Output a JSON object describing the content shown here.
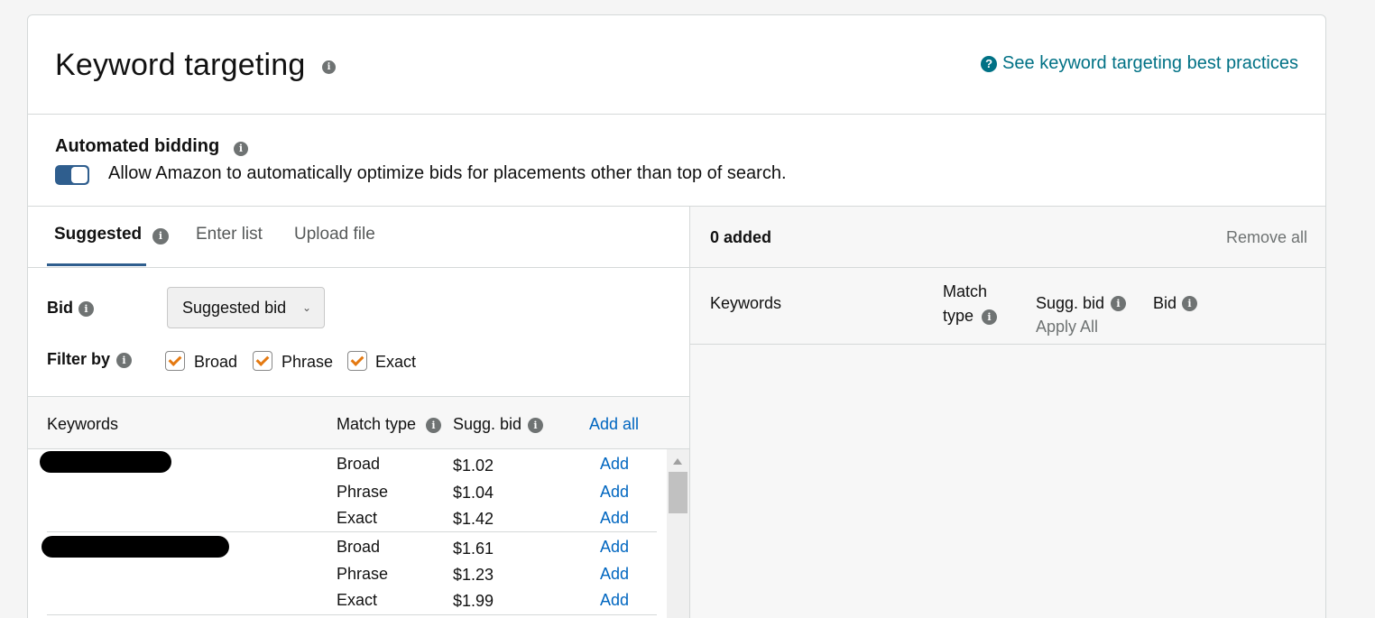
{
  "header": {
    "title": "Keyword targeting",
    "best_practices_link": "See keyword targeting best practices"
  },
  "automated_bidding": {
    "title": "Automated bidding",
    "toggle_on": true,
    "description": "Allow Amazon to automatically optimize bids for placements other than top of search."
  },
  "tabs": [
    {
      "label": "Suggested",
      "active": true
    },
    {
      "label": "Enter list",
      "active": false
    },
    {
      "label": "Upload file",
      "active": false
    }
  ],
  "filters": {
    "bid_label": "Bid",
    "bid_selected": "Suggested bid",
    "filter_label": "Filter by",
    "match_options": [
      {
        "label": "Broad",
        "checked": true
      },
      {
        "label": "Phrase",
        "checked": true
      },
      {
        "label": "Exact",
        "checked": true
      }
    ]
  },
  "keywords_table": {
    "col_keywords": "Keywords",
    "col_match_type": "Match type",
    "col_sugg_bid": "Sugg. bid",
    "add_all": "Add all",
    "add_label": "Add",
    "groups": [
      {
        "keyword_redacted": true,
        "rows": [
          {
            "match": "Broad",
            "bid": "$1.02"
          },
          {
            "match": "Phrase",
            "bid": "$1.04"
          },
          {
            "match": "Exact",
            "bid": "$1.42"
          }
        ]
      },
      {
        "keyword_redacted": true,
        "rows": [
          {
            "match": "Broad",
            "bid": "$1.61"
          },
          {
            "match": "Phrase",
            "bid": "$1.23"
          },
          {
            "match": "Exact",
            "bid": "$1.99"
          }
        ]
      }
    ]
  },
  "added_panel": {
    "count_label": "0 added",
    "remove_all": "Remove all",
    "col_keywords": "Keywords",
    "col_match_line1": "Match",
    "col_match_line2": "type",
    "col_sugg_bid": "Sugg. bid",
    "apply_all": "Apply All",
    "col_bid": "Bid"
  },
  "colors": {
    "link": "#0066c0",
    "teal_link": "#007185",
    "toggle": "#2f5e8e",
    "checkbox": "#e47911"
  }
}
